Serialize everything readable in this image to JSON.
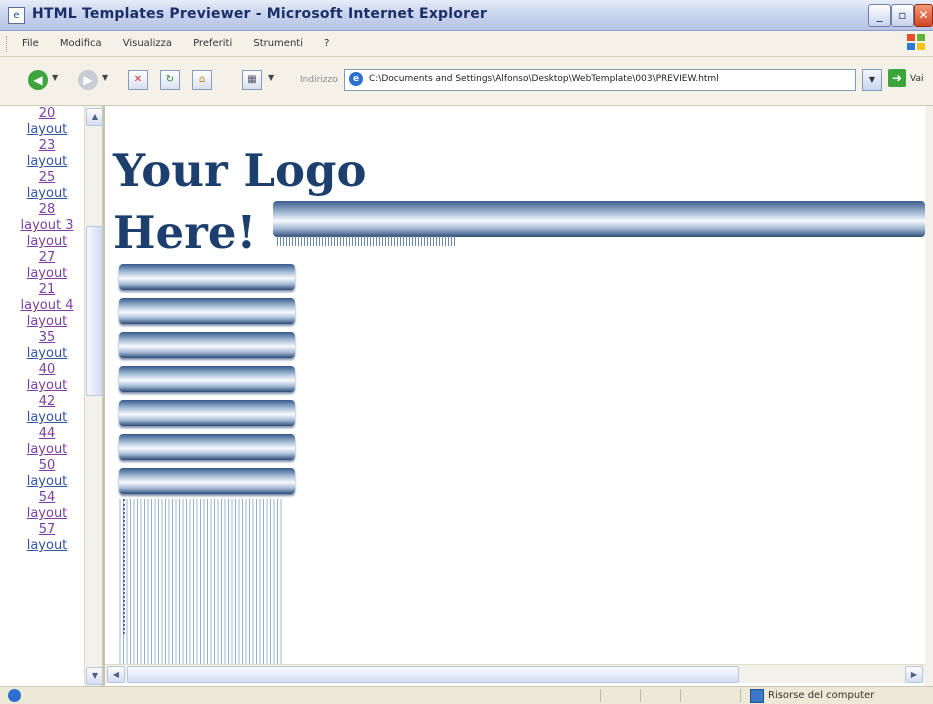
{
  "window": {
    "title": "HTML Templates Previewer - Microsoft Internet Explorer",
    "minimize": "_",
    "maximize": "▫",
    "close": "✕"
  },
  "menu": [
    "File",
    "Modifica",
    "Visualizza",
    "Preferiti",
    "Strumenti",
    "?"
  ],
  "toolbar": {
    "address_label": "Indirizzo",
    "address_value": "C:\\Documents and Settings\\Alfonso\\Desktop\\WebTemplate\\003\\PREVIEW.html",
    "go_label": "Vai"
  },
  "sidebar": {
    "links": [
      {
        "text": "20"
      },
      {
        "text": "layout"
      },
      {
        "text": "23"
      },
      {
        "text": "layout"
      },
      {
        "text": "25"
      },
      {
        "text": "layout"
      },
      {
        "text": "28"
      },
      {
        "text": "layout 3"
      },
      {
        "text": "layout"
      },
      {
        "text": "27"
      },
      {
        "text": "layout"
      },
      {
        "text": "21"
      },
      {
        "text": "layout 4"
      },
      {
        "text": "layout"
      },
      {
        "text": "35"
      },
      {
        "text": "layout"
      },
      {
        "text": "40"
      },
      {
        "text": "layout"
      },
      {
        "text": "42"
      },
      {
        "text": "layout"
      },
      {
        "text": "44"
      },
      {
        "text": "layout"
      },
      {
        "text": "50"
      },
      {
        "text": "layout"
      },
      {
        "text": "54"
      },
      {
        "text": "layout"
      },
      {
        "text": "57"
      },
      {
        "text": "layout"
      }
    ]
  },
  "main": {
    "logo_line1": "Your Logo",
    "logo_line2": "Here!",
    "nav_button_count": 7
  },
  "status": {
    "zone": "Risorse del computer"
  }
}
